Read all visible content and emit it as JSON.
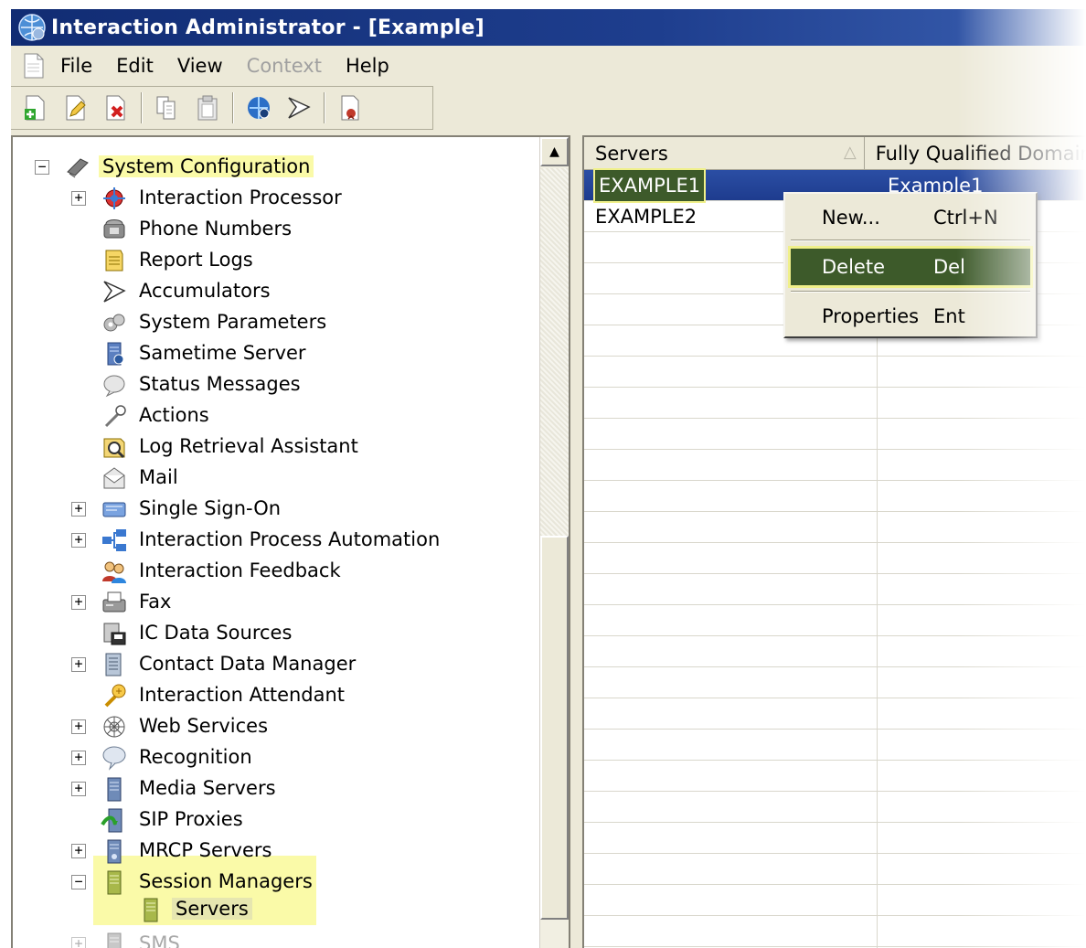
{
  "window": {
    "title": "Interaction Administrator - [Example]"
  },
  "menu": {
    "items": [
      {
        "label": "File",
        "enabled": true
      },
      {
        "label": "Edit",
        "enabled": true
      },
      {
        "label": "View",
        "enabled": true
      },
      {
        "label": "Context",
        "enabled": false
      },
      {
        "label": "Help",
        "enabled": true
      }
    ]
  },
  "toolbar": {
    "buttons": [
      "new-icon",
      "edit-icon",
      "delete-icon",
      "copy-icon",
      "paste-icon",
      "connect-icon",
      "accumulator-icon",
      "report-icon"
    ]
  },
  "tree": {
    "root": "System Configuration",
    "nodes": [
      {
        "label": "Interaction Processor",
        "icon": "interaction-processor-icon",
        "expander": "+"
      },
      {
        "label": "Phone Numbers",
        "icon": "phone-icon",
        "expander": ""
      },
      {
        "label": "Report Logs",
        "icon": "report-logs-icon",
        "expander": ""
      },
      {
        "label": "Accumulators",
        "icon": "accumulators-icon",
        "expander": ""
      },
      {
        "label": "System Parameters",
        "icon": "system-parameters-icon",
        "expander": ""
      },
      {
        "label": "Sametime Server",
        "icon": "sametime-server-icon",
        "expander": ""
      },
      {
        "label": "Status Messages",
        "icon": "status-messages-icon",
        "expander": ""
      },
      {
        "label": "Actions",
        "icon": "actions-icon",
        "expander": ""
      },
      {
        "label": "Log Retrieval Assistant",
        "icon": "log-retrieval-icon",
        "expander": ""
      },
      {
        "label": "Mail",
        "icon": "mail-icon",
        "expander": ""
      },
      {
        "label": "Single Sign-On",
        "icon": "single-sign-on-icon",
        "expander": "+"
      },
      {
        "label": "Interaction Process Automation",
        "icon": "process-automation-icon",
        "expander": "+"
      },
      {
        "label": "Interaction Feedback",
        "icon": "feedback-icon",
        "expander": ""
      },
      {
        "label": "Fax",
        "icon": "fax-icon",
        "expander": "+"
      },
      {
        "label": "IC Data Sources",
        "icon": "data-sources-icon",
        "expander": ""
      },
      {
        "label": "Contact Data Manager",
        "icon": "contact-data-icon",
        "expander": "+"
      },
      {
        "label": "Interaction Attendant",
        "icon": "attendant-icon",
        "expander": ""
      },
      {
        "label": "Web Services",
        "icon": "web-services-icon",
        "expander": "+"
      },
      {
        "label": "Recognition",
        "icon": "recognition-icon",
        "expander": "+"
      },
      {
        "label": "Media Servers",
        "icon": "media-servers-icon",
        "expander": "+"
      },
      {
        "label": "SIP Proxies",
        "icon": "sip-proxies-icon",
        "expander": ""
      },
      {
        "label": "MRCP Servers",
        "icon": "mrcp-servers-icon",
        "expander": "+"
      },
      {
        "label": "Session Managers",
        "icon": "session-managers-icon",
        "expander": "−"
      }
    ],
    "child": "Servers",
    "partial": "SMS"
  },
  "list": {
    "columns": [
      "Servers",
      "Fully Qualified Domain"
    ],
    "rows": [
      {
        "server": "EXAMPLE1",
        "fqdn": "Example1"
      },
      {
        "server": "EXAMPLE2",
        "fqdn": ""
      }
    ]
  },
  "context_menu": {
    "items": [
      {
        "label": "New...",
        "shortcut": "Ctrl+N"
      },
      {
        "label": "Delete",
        "shortcut": "Del"
      },
      {
        "label": "Properties",
        "shortcut": "Ent"
      }
    ]
  },
  "colors": {
    "titlebar": "#112c73",
    "highlight": "#fafaa8",
    "menu_selection": "#3d5a2a",
    "row_selection": "#2b4ea4"
  }
}
